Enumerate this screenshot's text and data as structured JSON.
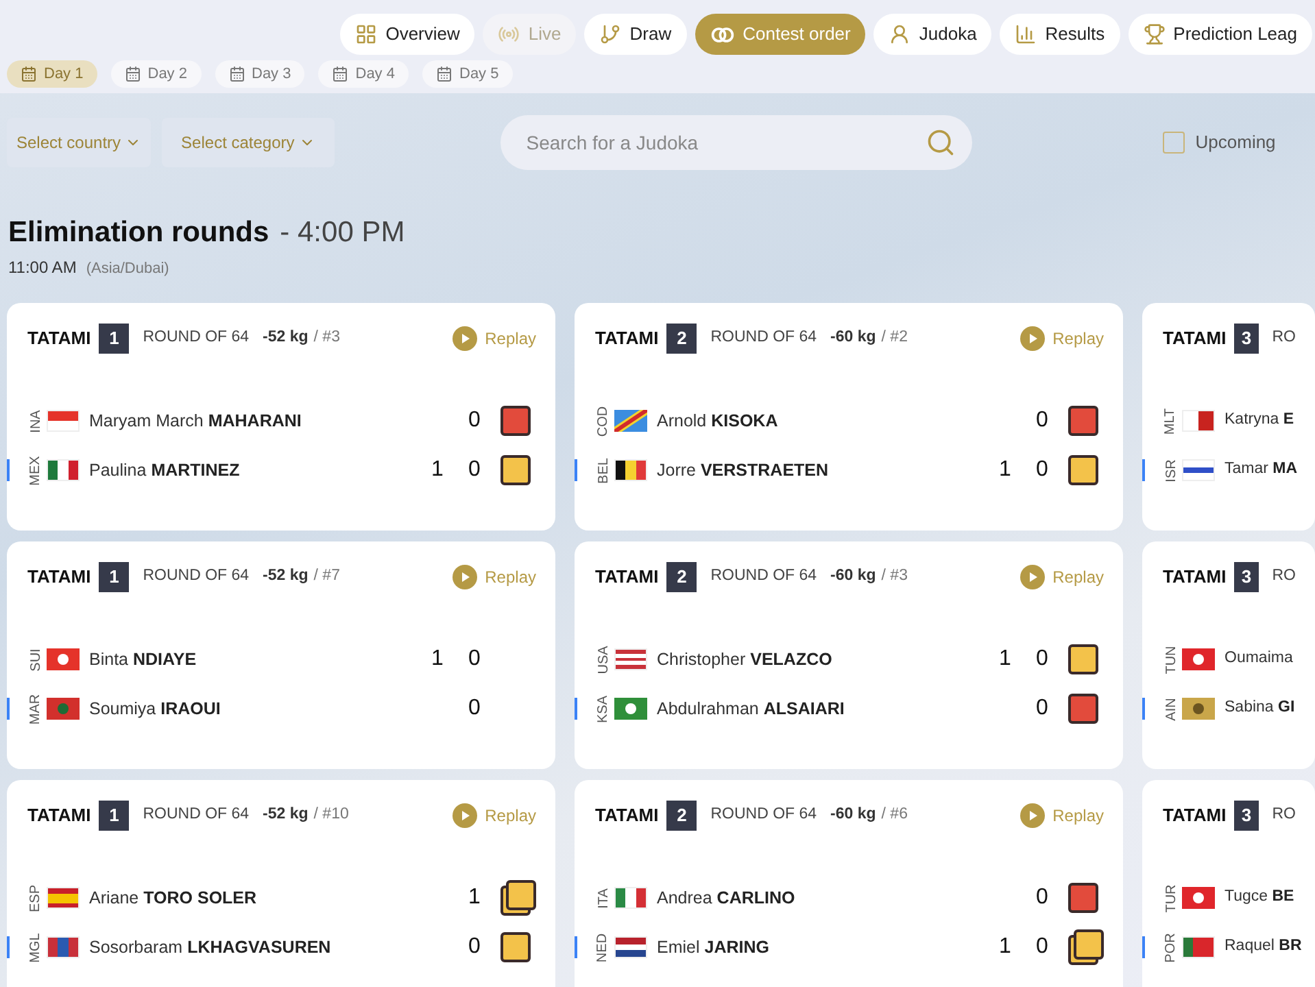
{
  "nav": [
    {
      "label": "Overview",
      "selected": false,
      "disabled": false
    },
    {
      "label": "Live",
      "selected": false,
      "disabled": true
    },
    {
      "label": "Draw",
      "selected": false,
      "disabled": false
    },
    {
      "label": "Contest order",
      "selected": true,
      "disabled": false
    },
    {
      "label": "Judoka",
      "selected": false,
      "disabled": false
    },
    {
      "label": "Results",
      "selected": false,
      "disabled": false
    },
    {
      "label": "Prediction Leag",
      "selected": false,
      "disabled": false
    }
  ],
  "days": [
    {
      "label": "Day 1",
      "selected": true
    },
    {
      "label": "Day 2",
      "selected": false
    },
    {
      "label": "Day 3",
      "selected": false
    },
    {
      "label": "Day 4",
      "selected": false
    },
    {
      "label": "Day 5",
      "selected": false
    }
  ],
  "filters": {
    "country": "Select country",
    "category": "Select category",
    "search_placeholder": "Search for a Judoka",
    "upcoming": {
      "label": "Upcoming",
      "checked": false
    }
  },
  "heading": {
    "title": "Elimination rounds",
    "time": "- 4:00 PM",
    "local_time": "11:00 AM",
    "timezone": "(Asia/Dubai)"
  },
  "contests": [
    {
      "tatami": "TATAMI",
      "mat": "1",
      "round": "ROUND OF 64",
      "weight": "-52 kg",
      "number": "/ #3",
      "replay": "Replay",
      "players": [
        {
          "code": "INA",
          "first": "Maryam March",
          "last": "MAHARANI",
          "score2": "0",
          "kind": "red_card"
        },
        {
          "code": "MEX",
          "first": "Paulina",
          "last": "MARTINEZ",
          "score1": "1",
          "score2": "0",
          "kind": "yellow_card"
        }
      ]
    },
    {
      "tatami": "TATAMI",
      "mat": "2",
      "round": "ROUND OF 64",
      "weight": "-60 kg",
      "number": "/ #2",
      "replay": "Replay",
      "players": [
        {
          "code": "COD",
          "first": "Arnold",
          "last": "KISOKA",
          "score2": "0",
          "kind": "red_card"
        },
        {
          "code": "BEL",
          "first": "Jorre",
          "last": "VERSTRAETEN",
          "score1": "1",
          "score2": "0",
          "kind": "yellow_card"
        }
      ]
    },
    {
      "tatami": "TATAMI",
      "mat": "3",
      "round": "RO",
      "players": [
        {
          "code": "MLT",
          "first": "Katryna",
          "last": "E"
        },
        {
          "code": "ISR",
          "first": "Tamar",
          "last": "MA"
        }
      ]
    },
    {
      "tatami": "TATAMI",
      "mat": "1",
      "round": "ROUND OF 64",
      "weight": "-52 kg",
      "number": "/ #7",
      "replay": "Replay",
      "players": [
        {
          "code": "SUI",
          "first": "Binta",
          "last": "NDIAYE",
          "score1": "1",
          "score2": "0",
          "kind": "no_card"
        },
        {
          "code": "MAR",
          "first": "Soumiya",
          "last": "IRAOUI",
          "score2": "0",
          "kind": "no_card"
        }
      ]
    },
    {
      "tatami": "TATAMI",
      "mat": "2",
      "round": "ROUND OF 64",
      "weight": "-60 kg",
      "number": "/ #3",
      "replay": "Replay",
      "players": [
        {
          "code": "USA",
          "first": "Christopher",
          "last": "VELAZCO",
          "score1": "1",
          "score2": "0",
          "kind": "yellow_card"
        },
        {
          "code": "KSA",
          "first": "Abdulrahman",
          "last": "ALSAIARI",
          "score2": "0",
          "kind": "red_card"
        }
      ]
    },
    {
      "tatami": "TATAMI",
      "mat": "3",
      "round": "RO",
      "players": [
        {
          "code": "TUN",
          "first": "Oumaima"
        },
        {
          "code": "AIN",
          "first": "Sabina",
          "last": "GI"
        }
      ]
    },
    {
      "tatami": "TATAMI",
      "mat": "1",
      "round": "ROUND OF 64",
      "weight": "-52 kg",
      "number": "/ #10",
      "replay": "Replay",
      "players": [
        {
          "code": "ESP",
          "first": "Ariane",
          "last": "TORO SOLER",
          "score2": "1",
          "kind": "two_yellow_cards"
        },
        {
          "code": "MGL",
          "first": "Sosorbaram",
          "last": "LKHAGVASUREN",
          "score2": "0",
          "kind": "yellow_card"
        }
      ]
    },
    {
      "tatami": "TATAMI",
      "mat": "2",
      "round": "ROUND OF 64",
      "weight": "-60 kg",
      "number": "/ #6",
      "replay": "Replay",
      "players": [
        {
          "code": "ITA",
          "first": "Andrea",
          "last": "CARLINO",
          "score2": "0",
          "kind": "red_card"
        },
        {
          "code": "NED",
          "first": "Emiel",
          "last": "JARING",
          "score1": "1",
          "score2": "0",
          "kind": "two_yellow_cards"
        }
      ]
    },
    {
      "tatami": "TATAMI",
      "mat": "3",
      "round": "RO",
      "players": [
        {
          "code": "TUR",
          "first": "Tugce",
          "last": "BE"
        },
        {
          "code": "POR",
          "first": "Raquel",
          "last": "BR"
        }
      ]
    }
  ]
}
